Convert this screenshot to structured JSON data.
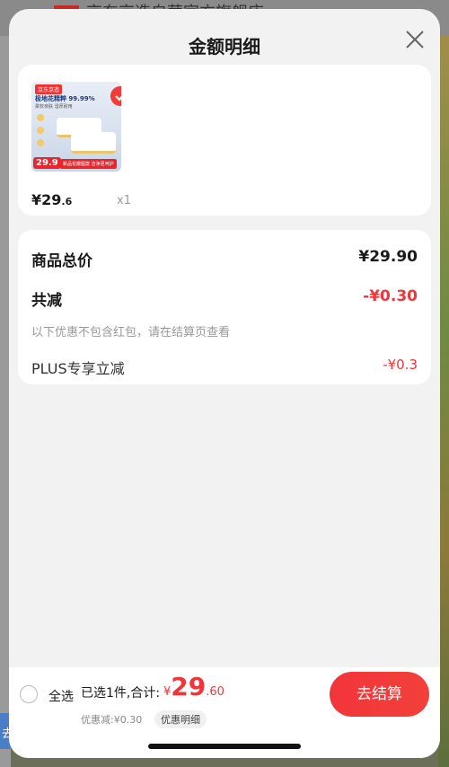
{
  "backdrop": {
    "store_name": "京东京造自营官方旗舰店 >",
    "bottom_btn": "去选"
  },
  "sheet": {
    "title": "金额明细"
  },
  "product": {
    "thumb_brand": "京东京造",
    "thumb_headline": "极地花精粹 99.99%",
    "thumb_sub": "柔软亲肤 湿厚耐用",
    "thumb_price": "29.9",
    "thumb_tag": "新品花瓣图案 洁净更呵护",
    "price_int": "¥29",
    "price_dec": ".6",
    "qty": "x1"
  },
  "price_detail": {
    "total_label": "商品总价",
    "total_value": "¥29.90",
    "reduce_label": "共减",
    "reduce_value": "-¥0.30",
    "note": "以下优惠不包含红包，请在结算页查看",
    "plus_label": "PLUS专享立减",
    "plus_value": "-¥0.3"
  },
  "footer": {
    "select_all": "全选",
    "summary": "已选1件,合计:",
    "total_cur": "¥",
    "total_int": "29",
    "total_dec": ".60",
    "saved": "优惠减:¥0.30",
    "detail_pill": "优惠明细",
    "checkout": "去结算"
  },
  "colors": {
    "accent": "#f2353a",
    "sheet_bg": "#f2f2f2",
    "card_bg": "#ffffff"
  }
}
